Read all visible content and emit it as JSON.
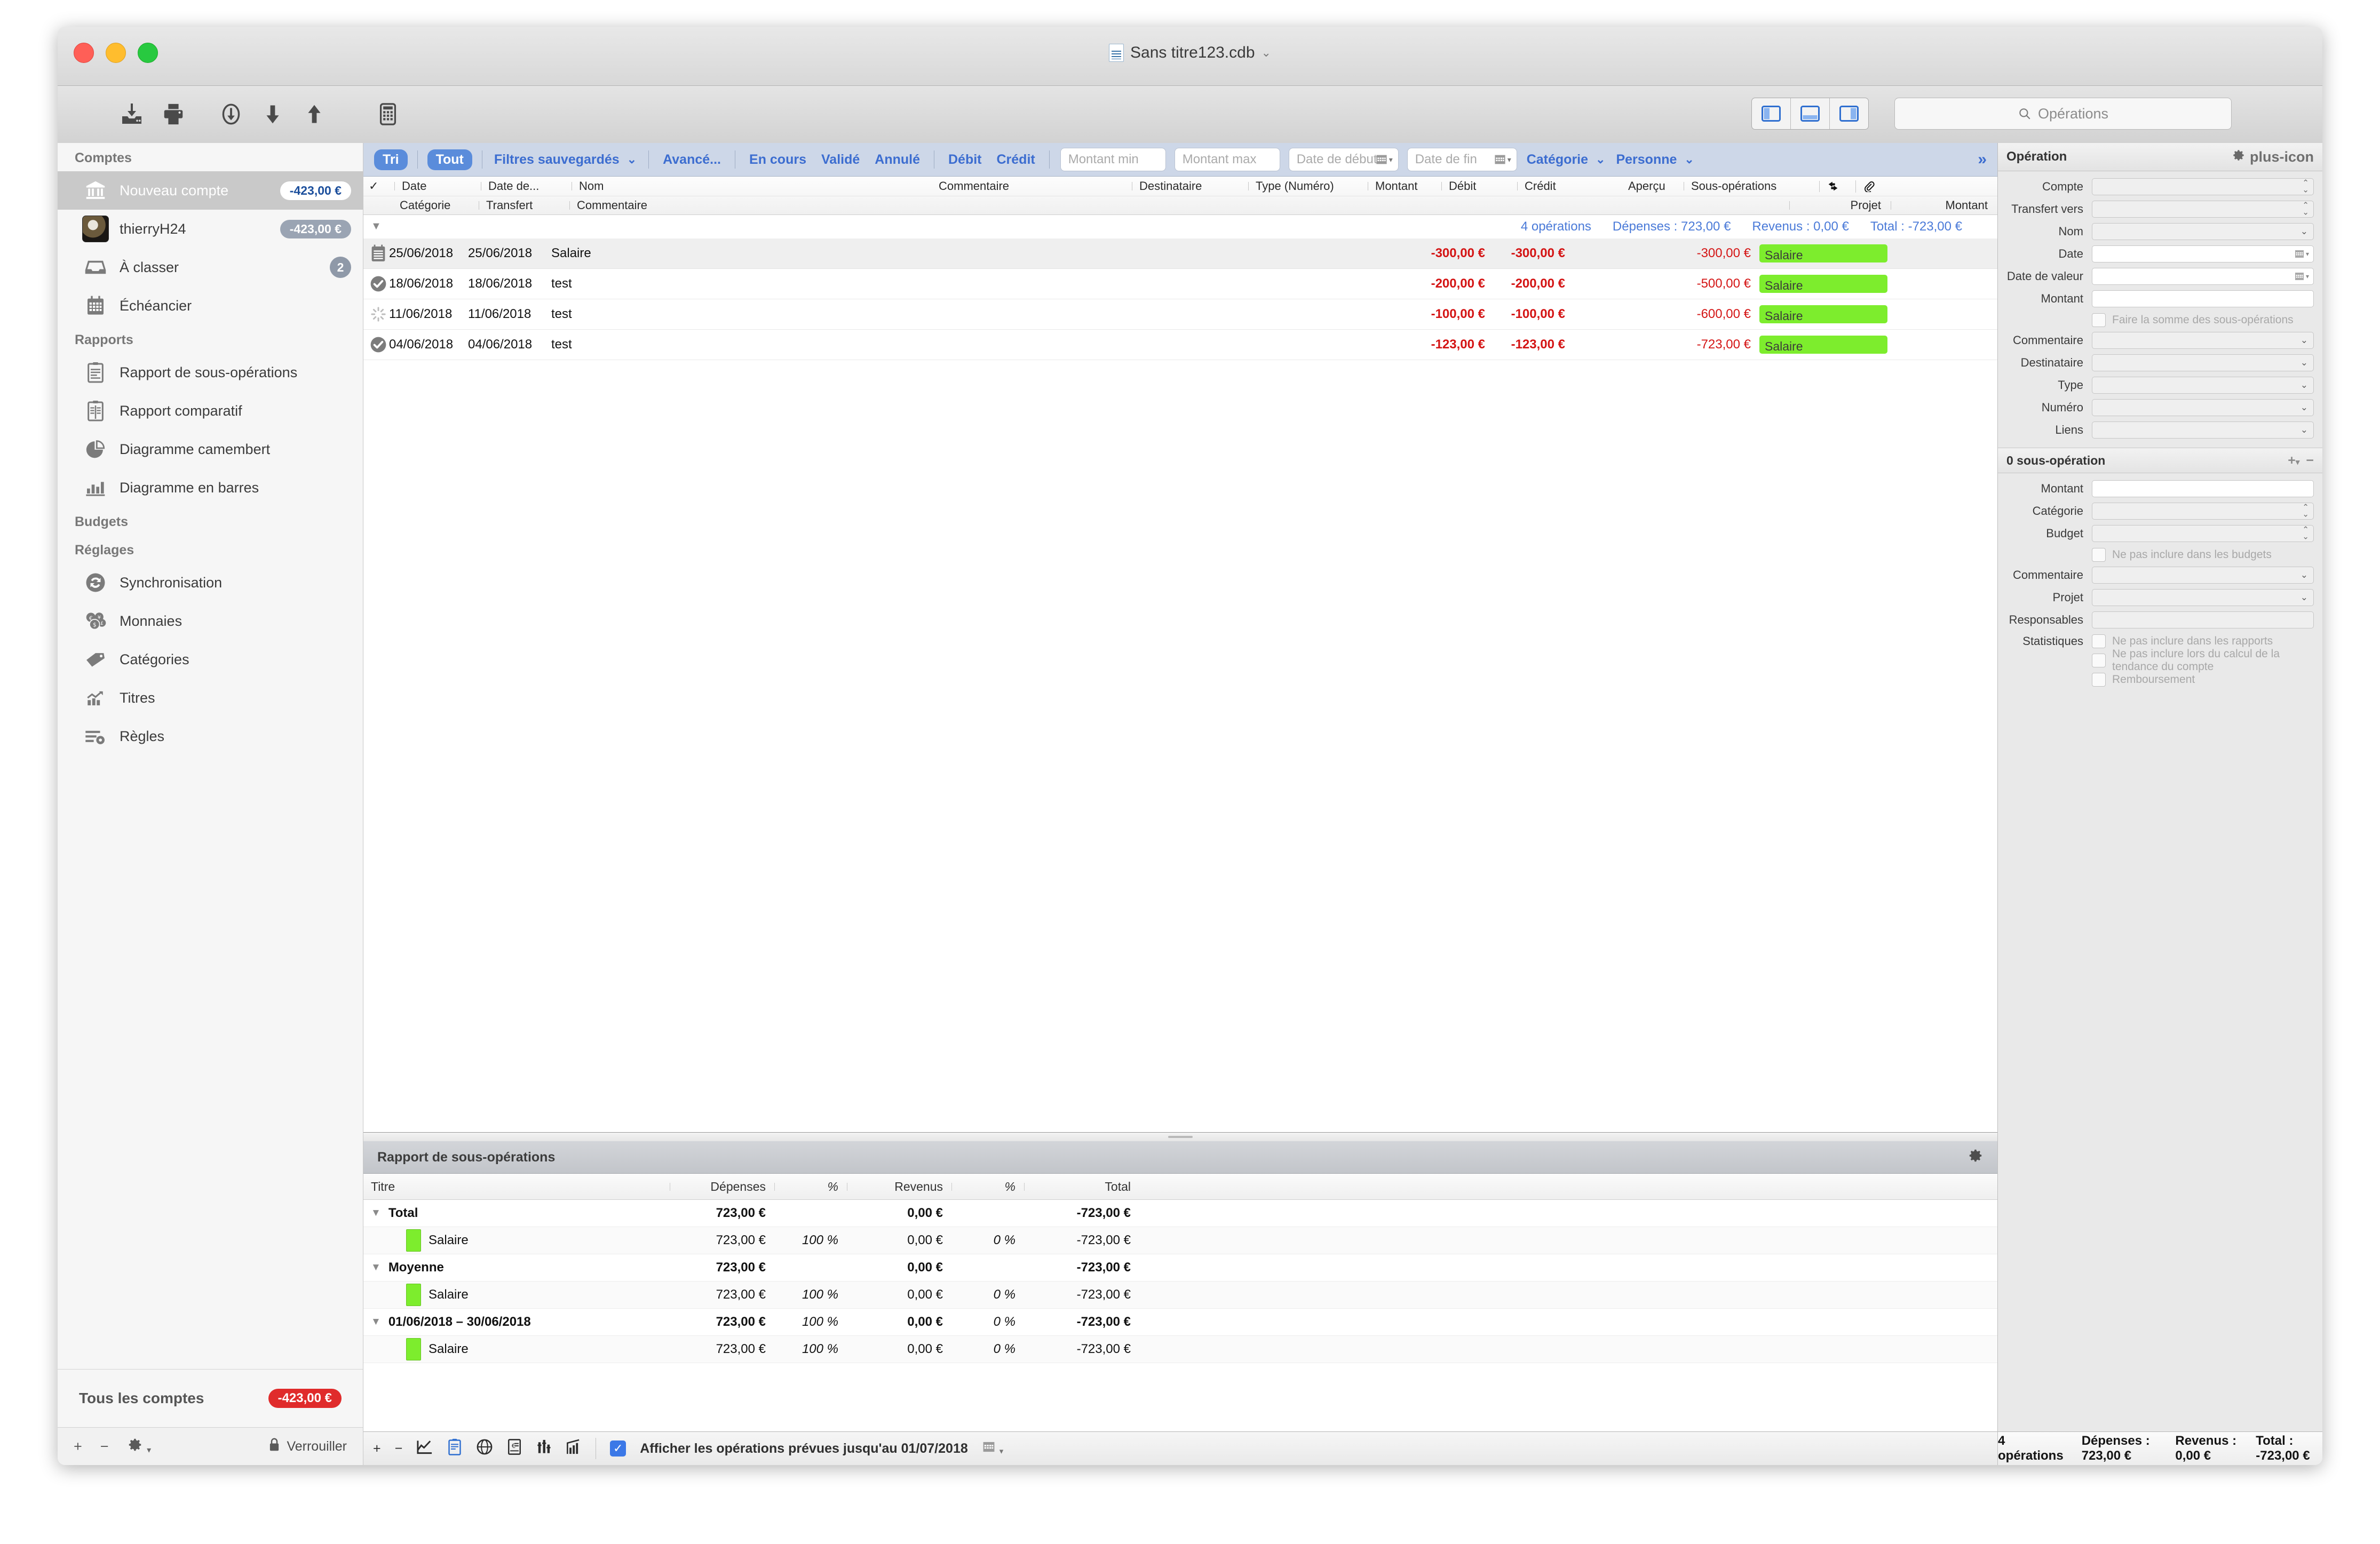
{
  "window": {
    "doc_title": "Sans titre123.cdb",
    "doc_icon": "bank-document-icon",
    "title_chevron": "⌄"
  },
  "toolbar": {
    "buttons": [
      {
        "name": "import-icon",
        "label": "Importer"
      },
      {
        "name": "print-icon",
        "label": "Imprimer"
      },
      {
        "name": "download-circle-icon",
        "label": "Télécharger"
      },
      {
        "name": "arrow-down-icon",
        "label": "Descendre"
      },
      {
        "name": "arrow-up-icon",
        "label": "Monter"
      },
      {
        "name": "calculator-icon",
        "label": "Calculatrice"
      }
    ],
    "view_modes": [
      "sidebar-left-icon",
      "panel-bottom-icon",
      "sidebar-right-icon"
    ],
    "search_placeholder": "Opérations",
    "search_icon": "search-icon"
  },
  "sidebar": {
    "groups": [
      {
        "title": "Comptes",
        "items": [
          {
            "icon": "bank-icon",
            "label": "Nouveau compte",
            "pill": "-423,00 €",
            "pill_style": "white",
            "selected": true
          },
          {
            "icon": "avatar",
            "label": "thierryH24",
            "pill": "-423,00 €",
            "pill_style": "grey",
            "selected": false
          },
          {
            "icon": "inbox-icon",
            "label": "À classer",
            "badge": "2",
            "selected": false
          },
          {
            "icon": "calendar-icon",
            "label": "Échéancier",
            "selected": false
          }
        ]
      },
      {
        "title": "Rapports",
        "items": [
          {
            "icon": "clipboard-lines-icon",
            "label": "Rapport de sous-opérations"
          },
          {
            "icon": "clipboard-compare-icon",
            "label": "Rapport comparatif"
          },
          {
            "icon": "pie-chart-icon",
            "label": "Diagramme camembert"
          },
          {
            "icon": "bar-chart-icon",
            "label": "Diagramme en barres"
          }
        ]
      },
      {
        "title": "Budgets",
        "items": []
      },
      {
        "title": "Réglages",
        "items": [
          {
            "icon": "sync-icon",
            "label": "Synchronisation"
          },
          {
            "icon": "coins-icon",
            "label": "Monnaies"
          },
          {
            "icon": "tag-icon",
            "label": "Catégories"
          },
          {
            "icon": "trend-chart-icon",
            "label": "Titres"
          },
          {
            "icon": "rules-gear-icon",
            "label": "Règles"
          }
        ]
      }
    ],
    "total_label": "Tous les comptes",
    "total_value": "-423,00 €",
    "footer": {
      "add": "+",
      "remove": "−",
      "gear": "gear-icon",
      "lock_label": "Verrouiller",
      "lock_icon": "lock-icon"
    }
  },
  "filterbar": {
    "chips": [
      "Tri",
      "Tout"
    ],
    "saved_filters_label": "Filtres sauvegardés",
    "advanced_label": "Avancé...",
    "status_filters": [
      "En cours",
      "Validé",
      "Annulé"
    ],
    "flow_filters": [
      "Débit",
      "Crédit"
    ],
    "amount_min_placeholder": "Montant min",
    "amount_max_placeholder": "Montant max",
    "date_start_placeholder": "Date de début",
    "date_end_placeholder": "Date de fin",
    "category_label": "Catégorie",
    "person_label": "Personne",
    "more_icon": "double-chevron-right-icon"
  },
  "operations_table": {
    "headers_row1": [
      "✓",
      "Date",
      "Date de...",
      "Nom",
      "Commentaire",
      "Destinataire",
      "Type (Numéro)",
      "Montant",
      "Débit",
      "Crédit",
      "Aperçu",
      "Sous-opérations"
    ],
    "headers_row2": [
      "Catégorie",
      "Transfert",
      "Commentaire",
      "Projet",
      "Montant"
    ],
    "header_icons": [
      "transfer-arrows-icon",
      "paperclip-icon"
    ],
    "summary": {
      "count": "4 opérations",
      "expenses": "Dépenses : 723,00 €",
      "income": "Revenus : 0,00 €",
      "total": "Total : -723,00 €"
    },
    "rows": [
      {
        "status_icon": "scheduled-icon",
        "date": "25/06/2018",
        "value_date": "25/06/2018",
        "name": "Salaire",
        "amount": "-300,00 €",
        "debit": "-300,00 €",
        "credit": "",
        "balance": "-300,00 €",
        "suboperation": "Salaire"
      },
      {
        "status_icon": "validated-icon",
        "date": "18/06/2018",
        "value_date": "18/06/2018",
        "name": "test",
        "amount": "-200,00 €",
        "debit": "-200,00 €",
        "credit": "",
        "balance": "-500,00 €",
        "suboperation": "Salaire"
      },
      {
        "status_icon": "pending-icon",
        "date": "11/06/2018",
        "value_date": "11/06/2018",
        "name": "test",
        "amount": "-100,00 €",
        "debit": "-100,00 €",
        "credit": "",
        "balance": "-600,00 €",
        "suboperation": "Salaire"
      },
      {
        "status_icon": "validated-icon",
        "date": "04/06/2018",
        "value_date": "04/06/2018",
        "name": "test",
        "amount": "-123,00 €",
        "debit": "-123,00 €",
        "credit": "",
        "balance": "-723,00 €",
        "suboperation": "Salaire"
      }
    ]
  },
  "report": {
    "title": "Rapport de sous-opérations",
    "gear_icon": "gear-icon",
    "columns": [
      "Titre",
      "Dépenses",
      "%",
      "Revenus",
      "%",
      "Total"
    ],
    "rows": [
      {
        "type": "group",
        "title": "Total",
        "expenses": "723,00 €",
        "exp_pct": "",
        "income": "0,00 €",
        "inc_pct": "",
        "total": "-723,00 €"
      },
      {
        "type": "child",
        "title": "Salaire",
        "expenses": "723,00 €",
        "exp_pct": "100 %",
        "income": "0,00 €",
        "inc_pct": "0 %",
        "total": "-723,00 €"
      },
      {
        "type": "group",
        "title": "Moyenne",
        "expenses": "723,00 €",
        "exp_pct": "",
        "income": "0,00 €",
        "inc_pct": "",
        "total": "-723,00 €"
      },
      {
        "type": "child",
        "title": "Salaire",
        "expenses": "723,00 €",
        "exp_pct": "100 %",
        "income": "0,00 €",
        "inc_pct": "0 %",
        "total": "-723,00 €"
      },
      {
        "type": "group",
        "title": "01/06/2018 – 30/06/2018",
        "expenses": "723,00 €",
        "exp_pct": "100 %",
        "income": "0,00 €",
        "inc_pct": "0 %",
        "total": "-723,00 €"
      },
      {
        "type": "child",
        "title": "Salaire",
        "expenses": "723,00 €",
        "exp_pct": "100 %",
        "income": "0,00 €",
        "inc_pct": "0 %",
        "total": "-723,00 €"
      }
    ]
  },
  "center_statusbar": {
    "add": "+",
    "remove": "−",
    "icons": [
      "line-chart-icon",
      "clipboard-icon",
      "globe-icon",
      "invoice-icon",
      "compare-icon",
      "growth-icon"
    ],
    "checkbox_checked": true,
    "checkbox_label": "Afficher les opérations prévues jusqu'au 01/07/2018",
    "calendar_icon": "calendar-dropdown-icon"
  },
  "inspector": {
    "title": "Opération",
    "header_actions": [
      "gear-icon",
      "plus-icon"
    ],
    "fields": [
      {
        "label": "Compte",
        "kind": "stepper",
        "value": ""
      },
      {
        "label": "Transfert vers",
        "kind": "stepper",
        "value": ""
      },
      {
        "label": "Nom",
        "kind": "combo",
        "value": ""
      },
      {
        "label": "Date",
        "kind": "date",
        "value": ""
      },
      {
        "label": "Date de valeur",
        "kind": "date",
        "value": ""
      },
      {
        "label": "Montant",
        "kind": "text",
        "value": ""
      }
    ],
    "sum_checkbox_label": "Faire la somme des sous-opérations",
    "fields2": [
      {
        "label": "Commentaire",
        "kind": "combo",
        "value": ""
      },
      {
        "label": "Destinataire",
        "kind": "combo",
        "value": ""
      },
      {
        "label": "Type",
        "kind": "combo",
        "value": ""
      },
      {
        "label": "Numéro",
        "kind": "combo",
        "value": ""
      },
      {
        "label": "Liens",
        "kind": "combo-plain",
        "value": ""
      }
    ],
    "sub_section": {
      "title": "0 sous-opération",
      "actions": [
        "plus-dropdown-icon",
        "minus-icon"
      ],
      "fields": [
        {
          "label": "Montant",
          "kind": "text",
          "value": ""
        },
        {
          "label": "Catégorie",
          "kind": "stepper",
          "value": ""
        },
        {
          "label": "Budget",
          "kind": "stepper",
          "value": ""
        }
      ],
      "budget_checkbox_label": "Ne pas inclure dans les budgets",
      "fields_after": [
        {
          "label": "Commentaire",
          "kind": "combo",
          "value": ""
        },
        {
          "label": "Projet",
          "kind": "combo",
          "value": ""
        },
        {
          "label": "Responsables",
          "kind": "plain",
          "value": ""
        }
      ],
      "stats_label": "Statistiques",
      "stats_checkboxes": [
        "Ne pas inclure dans les rapports",
        "Ne pas inclure lors du calcul de la tendance du compte",
        "Remboursement"
      ]
    },
    "footer": {
      "count": "4 opérations",
      "expenses": "Dépenses : 723,00 €",
      "income": "Revenus : 0,00 €",
      "total": "Total : -723,00 €"
    }
  },
  "colors": {
    "accent_blue": "#3c6dd0",
    "filter_bar": "#cdd7e8",
    "negative_red": "#d41414",
    "category_green": "#7ded2d",
    "total_red": "#e02b2b"
  }
}
